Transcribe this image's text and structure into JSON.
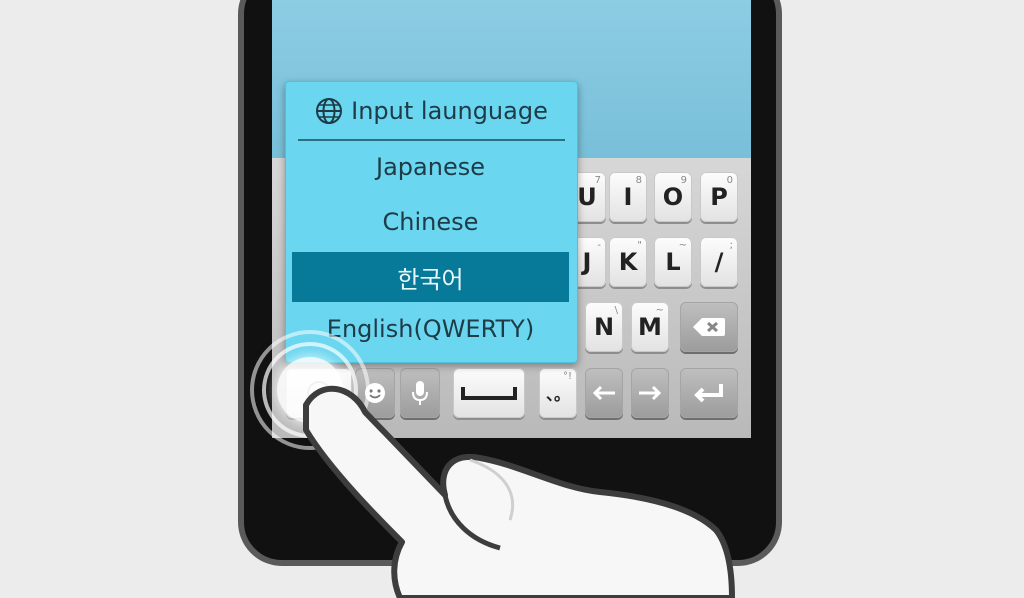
{
  "popup": {
    "title": "Input launguage",
    "items": [
      {
        "label": "Japanese",
        "selected": false
      },
      {
        "label": "Chinese",
        "selected": false
      },
      {
        "label": "한국어",
        "selected": true
      },
      {
        "label": "English(QWERTY)",
        "selected": false
      }
    ]
  },
  "keyboard": {
    "row1": [
      {
        "label": "U",
        "sub": "7"
      },
      {
        "label": "I",
        "sub": "8"
      },
      {
        "label": "O",
        "sub": "9"
      },
      {
        "label": "P",
        "sub": "0"
      }
    ],
    "row2": [
      {
        "label": "J",
        "sub": "-"
      },
      {
        "label": "K",
        "sub": "\""
      },
      {
        "label": "L",
        "sub": "~"
      },
      {
        "label": "/",
        "sub": ";"
      }
    ],
    "row3": [
      {
        "label": "N",
        "sub": "\\"
      },
      {
        "label": "M",
        "sub": "~"
      }
    ],
    "bottom": {
      "punct_label": "、。",
      "punct_sub": "°!"
    }
  },
  "colors": {
    "popup_bg": "#6ad6ef",
    "popup_selected": "#067a98",
    "screen_bg": "#7dc4de"
  },
  "icons": [
    "globe-icon",
    "emoji-icon",
    "microphone-icon",
    "backspace-icon",
    "space-icon",
    "cursor-left-icon",
    "cursor-right-icon",
    "enter-icon"
  ]
}
